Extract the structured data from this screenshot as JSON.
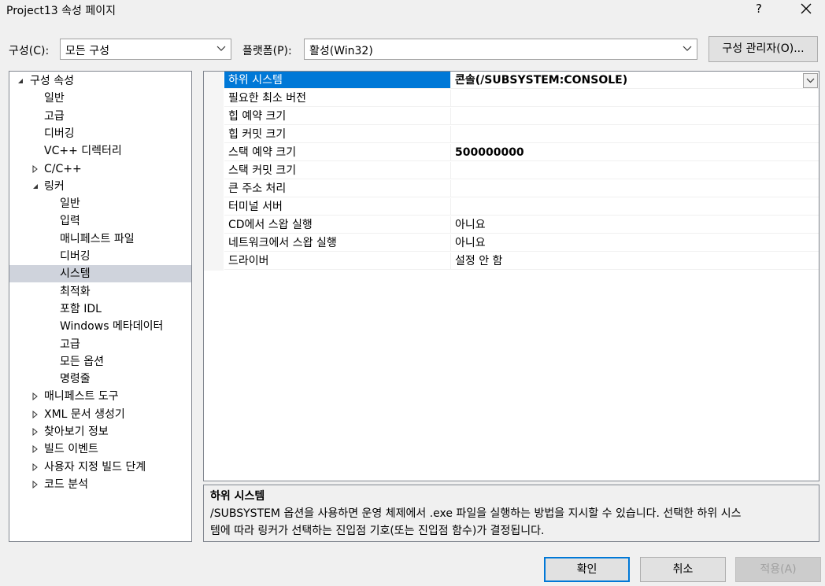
{
  "window": {
    "title": "Project13 속성 페이지",
    "help": "?"
  },
  "config": {
    "config_label": "구성(C):",
    "config_value": "모든 구성",
    "platform_label": "플랫폼(P):",
    "platform_value": "활성(Win32)",
    "manager_button": "구성 관리자(O)..."
  },
  "tree": {
    "items": [
      {
        "label": "구성 속성",
        "expander": "expanded"
      },
      {
        "label": "일반"
      },
      {
        "label": "고급"
      },
      {
        "label": "디버깅"
      },
      {
        "label": "VC++ 디렉터리"
      },
      {
        "label": "C/C++",
        "expander": "collapsed"
      },
      {
        "label": "링커",
        "expander": "expanded"
      },
      {
        "label": "일반"
      },
      {
        "label": "입력"
      },
      {
        "label": "매니페스트 파일"
      },
      {
        "label": "디버깅"
      },
      {
        "label": "시스템",
        "selected": true
      },
      {
        "label": "최적화"
      },
      {
        "label": "포함 IDL"
      },
      {
        "label": "Windows 메타데이터"
      },
      {
        "label": "고급"
      },
      {
        "label": "모든 옵션"
      },
      {
        "label": "명령줄"
      },
      {
        "label": "매니페스트 도구",
        "expander": "collapsed"
      },
      {
        "label": "XML 문서 생성기",
        "expander": "collapsed"
      },
      {
        "label": "찾아보기 정보",
        "expander": "collapsed"
      },
      {
        "label": "빌드 이벤트",
        "expander": "collapsed"
      },
      {
        "label": "사용자 지정 빌드 단계",
        "expander": "collapsed"
      },
      {
        "label": "코드 분석",
        "expander": "collapsed"
      }
    ]
  },
  "properties": [
    {
      "name": "하위 시스템",
      "value": "콘솔(/SUBSYSTEM:CONSOLE)",
      "bold": true,
      "selected": true
    },
    {
      "name": "필요한 최소 버전",
      "value": ""
    },
    {
      "name": "힙 예약 크기",
      "value": ""
    },
    {
      "name": "힙 커밋 크기",
      "value": ""
    },
    {
      "name": "스택 예약 크기",
      "value": "500000000",
      "bold": true
    },
    {
      "name": "스택 커밋 크기",
      "value": ""
    },
    {
      "name": "큰 주소 처리",
      "value": ""
    },
    {
      "name": "터미널 서버",
      "value": ""
    },
    {
      "name": "CD에서 스왑 실행",
      "value": "아니요"
    },
    {
      "name": "네트워크에서 스왑 실행",
      "value": "아니요"
    },
    {
      "name": "드라이버",
      "value": "설정 안 함"
    }
  ],
  "description": {
    "title": "하위 시스템",
    "line1": "/SUBSYSTEM 옵션을 사용하면 운영 체제에서 .exe 파일을 실행하는 방법을 지시할 수 있습니다. 선택한 하위 시스",
    "line2": "템에 따라 링커가 선택하는 진입점 기호(또는 진입점 함수)가 결정됩니다."
  },
  "buttons": {
    "ok": "확인",
    "cancel": "취소",
    "apply": "적용(A)"
  },
  "colors": {
    "selection": "#0078d7",
    "tree_selection": "#cfd3dc"
  }
}
